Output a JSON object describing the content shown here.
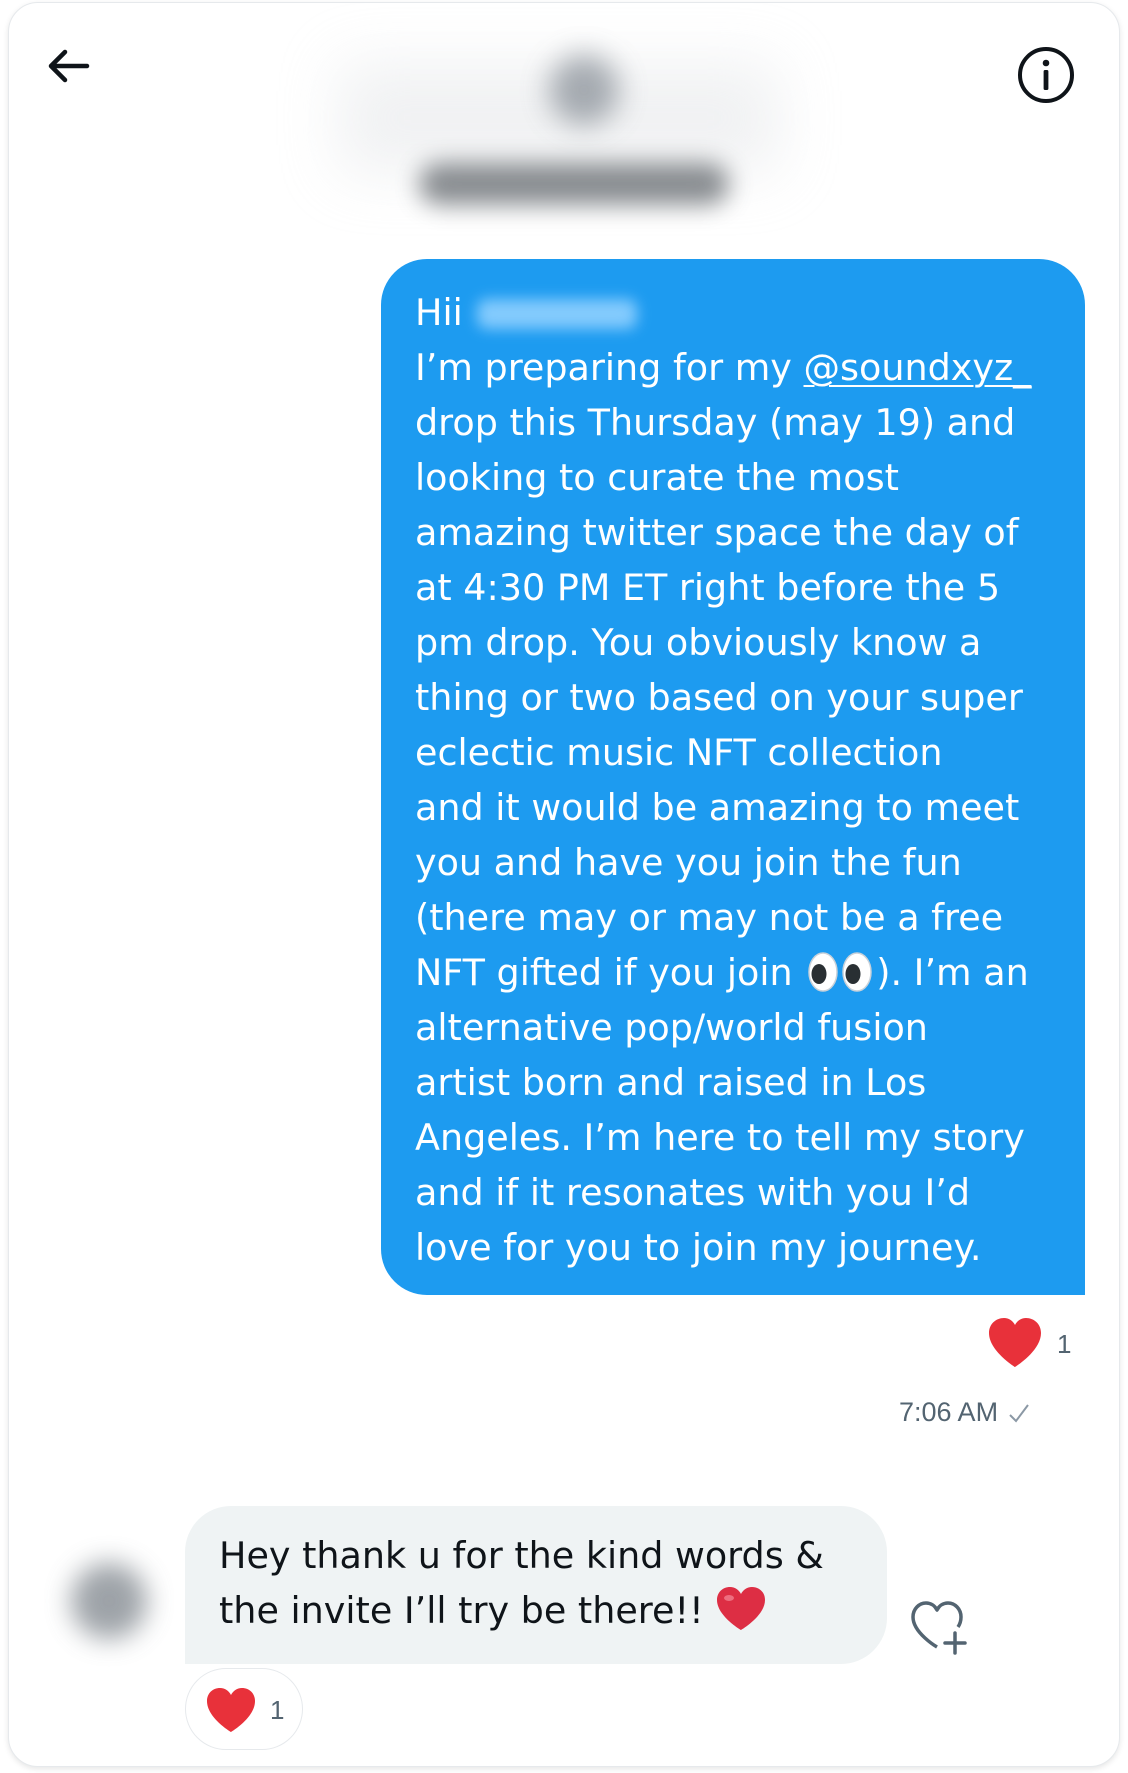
{
  "header": {
    "back_icon": "arrow-left-icon",
    "info_icon": "info-circle-icon"
  },
  "sent_message": {
    "line1": "Hii",
    "line2_prefix": "I’m preparing for my ",
    "mention": "@soundxyz_",
    "lines": [
      "drop this Thursday (may 19) and",
      "looking to curate the most",
      "amazing twitter space the day of",
      "at 4:30 PM ET right before the 5",
      "pm drop. You obviously know a",
      "thing or two based on your super",
      "eclectic music NFT collection",
      "and it would be amazing to meet",
      "you and have you join the fun",
      "(there may or may not be a free"
    ],
    "line_eyes_before": "NFT gifted if you join ",
    "line_eyes_after": "). I’m an",
    "lines_after": [
      "alternative pop/world fusion",
      "artist born and raised in Los",
      "Angeles. I’m here to tell my story",
      "and if it resonates with you I’d",
      "love for you to join my journey."
    ],
    "reaction_icon": "heart-icon",
    "reaction_count": "1",
    "time": "7:06 AM",
    "status_icon": "check-icon"
  },
  "received_message": {
    "line1": "Hey thank u for the kind words &",
    "line2": "the invite I’ll try be there!!",
    "emoji": "heart-emoji",
    "reaction_icon": "heart-icon",
    "reaction_count": "1",
    "add_reaction_icon": "add-reaction-icon"
  },
  "colors": {
    "sent_bubble": "#1d9bf0",
    "received_bubble": "#eff3f4",
    "heart": "#f4212e",
    "muted_text": "#536471"
  }
}
